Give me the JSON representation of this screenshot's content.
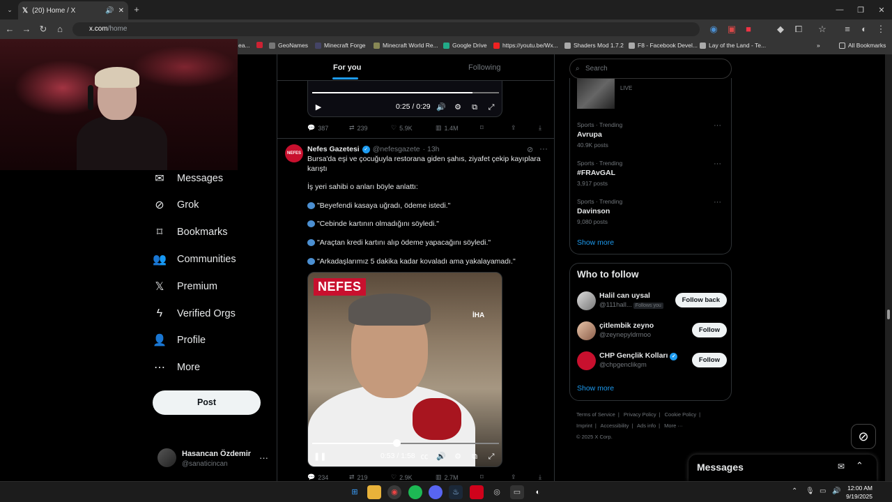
{
  "browser": {
    "tab_title": "(20) Home / X",
    "url_host": "x.com",
    "url_path": "/home",
    "bookmarks": [
      "ea...",
      "GeoNames",
      "Minecraft Forge",
      "Minecraft World Re...",
      "Google Drive",
      "https://youtu.be/Wx...",
      "Shaders Mod 1.7.2",
      "F8 - Facebook Devel...",
      "Lay of the Land - Te..."
    ],
    "all_bookmarks": "All Bookmarks",
    "overflow": "»"
  },
  "sidebar": {
    "items": [
      {
        "label": "Messages",
        "icon": "envelope-icon",
        "glyph": "✉"
      },
      {
        "label": "Grok",
        "icon": "grok-icon",
        "glyph": "⊘"
      },
      {
        "label": "Bookmarks",
        "icon": "bookmark-icon",
        "glyph": "⌑"
      },
      {
        "label": "Communities",
        "icon": "people-icon",
        "glyph": "👥"
      },
      {
        "label": "Premium",
        "icon": "x-logo-icon",
        "glyph": "𝕏"
      },
      {
        "label": "Verified Orgs",
        "icon": "lightning-icon",
        "glyph": "ϟ"
      },
      {
        "label": "Profile",
        "icon": "person-icon",
        "glyph": "👤"
      },
      {
        "label": "More",
        "icon": "more-circle-icon",
        "glyph": "⋯"
      }
    ],
    "post_label": "Post",
    "account": {
      "name": "Hasancan Özdemir",
      "handle": "@sanaticincan",
      "more": "···"
    }
  },
  "feed": {
    "tabs": [
      {
        "label": "For you",
        "active": true
      },
      {
        "label": "Following",
        "active": false
      }
    ],
    "video1": {
      "time": "0:25 / 0:29",
      "progress": 0.86
    },
    "post1_actions": {
      "replies": "387",
      "reposts": "239",
      "likes": "5.9K",
      "views": "1.4M"
    },
    "tweet": {
      "author": "Nefes Gazetesi",
      "handle": "@nefesgazete",
      "time": "· 13h",
      "avatar_text": "NEFES",
      "text": "Bursa'da eşi ve çocuğuyla restorana giden şahıs, ziyafet çekip kayıplara karıştı",
      "intro": "İş yeri sahibi o anları böyle anlattı:",
      "quotes": [
        "\"Beyefendi kasaya uğradı, ödeme istedi.\"",
        "\"Cebinde kartının olmadığını söyledi.\"",
        "\"Araçtan kredi kartını alıp ödeme yapacağını söyledi.\"",
        "\"Arkadaşlarımız 5 dakika kadar kovaladı ama yakalayamadı.\""
      ],
      "video_logo": "NEFES",
      "video_watermark": "İHA",
      "video_time": "0:53 / 1:58",
      "video_progress": 0.45
    },
    "post2_actions": {
      "replies": "234",
      "reposts": "219",
      "likes": "2.9K",
      "views": "2.7M"
    }
  },
  "right": {
    "search_placeholder": "Search",
    "live_label": "LIVE",
    "trends": [
      {
        "category": "Sports · Trending",
        "name": "Avrupa",
        "count": "40.9K posts"
      },
      {
        "category": "Sports · Trending",
        "name": "#FRAvGAL",
        "count": "3,917 posts"
      },
      {
        "category": "Sports · Trending",
        "name": "Davinson",
        "count": "9,080 posts"
      }
    ],
    "trends_show_more": "Show more",
    "who_to_follow": {
      "title": "Who to follow",
      "users": [
        {
          "name": "Halil can uysal",
          "handle": "@111hall...",
          "badge": "Follows you",
          "button": "Follow back",
          "verified": false
        },
        {
          "name": "çitlembik zeyno",
          "handle": "@zeynepyldrmoo",
          "badge": "",
          "button": "Follow",
          "verified": false
        },
        {
          "name": "CHP Gençlik Kolları",
          "handle": "@chpgenclikgm",
          "badge": "",
          "button": "Follow",
          "verified": true
        }
      ],
      "show_more": "Show more"
    },
    "footer": [
      "Terms of Service",
      "|",
      "Privacy Policy",
      "|",
      "Cookie Policy",
      "|",
      "Imprint",
      "|",
      "Accessibility",
      "|",
      "Ads info",
      "|",
      "More ···",
      "© 2025 X Corp."
    ]
  },
  "messages_dock": {
    "title": "Messages"
  },
  "taskbar": {
    "time": "12:00 AM",
    "date": "9/19/2025"
  },
  "colors": {
    "accent": "#1d9bf0",
    "bg": "#000000",
    "border": "#2f3336",
    "muted": "#71767b"
  }
}
